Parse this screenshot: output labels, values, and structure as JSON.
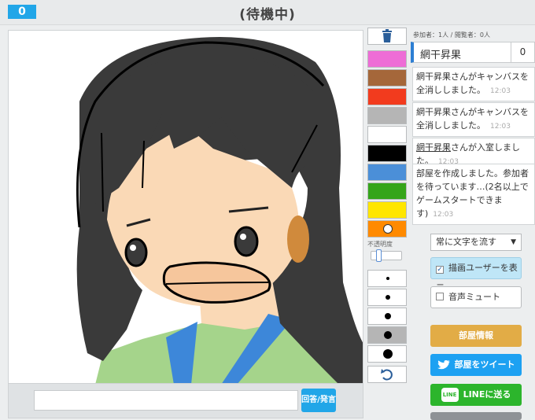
{
  "header": {
    "score_badge": "0",
    "status_title": "(待機中)"
  },
  "answer": {
    "input_value": "",
    "input_placeholder": "",
    "submit_label": "回答/発言"
  },
  "tools": {
    "trash_icon": "trash-icon",
    "palette": [
      "#ee6dd6",
      "#a5673a",
      "#f23b1e",
      "#b5b5b5",
      "#ffffff",
      "#000000",
      "#4b8fd8",
      "#35a51a",
      "#ffe600",
      "#ff8a00"
    ],
    "opacity_label": "不透明度",
    "opacity_value": 0.2,
    "brush_sizes": [
      1,
      2,
      3,
      4,
      5
    ],
    "undo_icon": "undo-icon"
  },
  "room": {
    "participants_text": "参加者：1人 / 閲覧者：0人",
    "players": [
      {
        "name": "網干昇果",
        "score": "0"
      }
    ]
  },
  "chat": [
    {
      "text": "網干昇果さんがキャンバスを全消ししました。",
      "time": "12:03"
    },
    {
      "text": "網干昇果さんがキャンバスを全消ししました。",
      "time": "12:03"
    },
    {
      "user": "網干昇果",
      "suffix": "さんが入室しました。",
      "time": "12:03"
    },
    {
      "text": "部屋を作成しました。参加者を待っています…(2名以上でゲームスタートできます)",
      "time": "12:03"
    }
  ],
  "controls": {
    "flow_select_value": "常に文字を流す",
    "show_drawer_label": "描画ユーザーを表示",
    "show_drawer_checked": true,
    "mute_label": "音声ミュート",
    "mute_checked": false,
    "room_info_label": "部屋情報",
    "tweet_label": "部屋をツイート",
    "line_label": "LINEに送る"
  },
  "colors": {
    "accent": "#21a6e8",
    "room_info": "#e2ac46",
    "tweet": "#1da1f2",
    "line": "#2cb52c"
  }
}
